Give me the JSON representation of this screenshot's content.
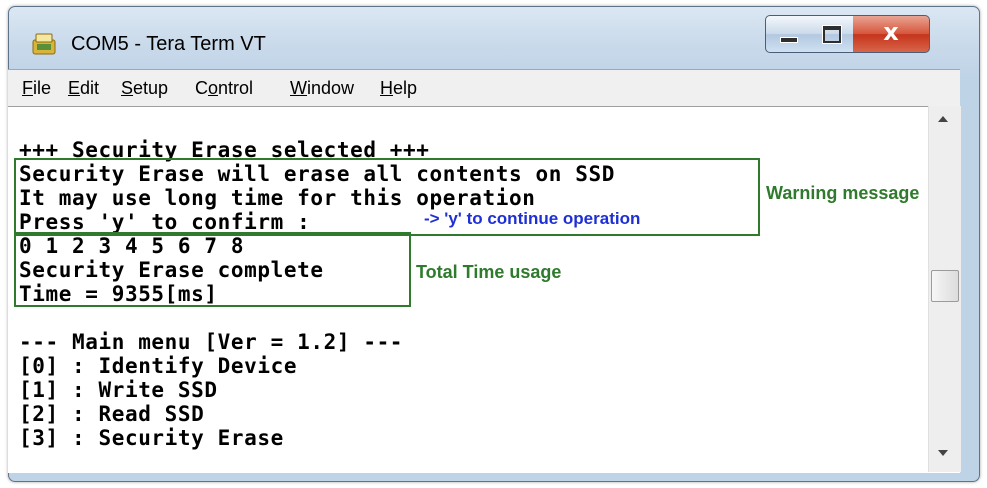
{
  "window": {
    "title": "COM5 - Tera Term VT",
    "controls": {
      "minimize": "minimize",
      "maximize": "maximize",
      "close": "x"
    }
  },
  "menu": [
    {
      "label": "File",
      "mnemonic": "F",
      "rest": "ile"
    },
    {
      "label": "Edit",
      "mnemonic": "E",
      "rest": "dit"
    },
    {
      "label": "Setup",
      "mnemonic": "S",
      "rest": "etup"
    },
    {
      "label": "Control",
      "pre": "C",
      "mnemonic": "o",
      "rest": "ntrol"
    },
    {
      "label": "Window",
      "mnemonic": "W",
      "rest": "indow"
    },
    {
      "label": "Help",
      "mnemonic": "H",
      "rest": "elp"
    }
  ],
  "terminal": {
    "lines": [
      "+++ Security Erase selected +++",
      "Security Erase will erase all contents on SSD",
      "It may use long time for this operation",
      "Press 'y' to confirm :",
      "0 1 2 3 4 5 6 7 8",
      "Security Erase complete",
      "Time = 9355[ms]",
      "",
      "--- Main menu [Ver = 1.2] ---",
      "[0] : Identify Device",
      "[1] : Write SSD",
      "[2] : Read SSD",
      "[3] : Security Erase"
    ]
  },
  "annotations": {
    "warning": "Warning message",
    "continue": "-> 'y' to continue operation",
    "total_time": "Total Time usage",
    "colors": {
      "green": "#2f7a2c",
      "blue": "#1f2fd6",
      "box": "#2f7a2c"
    }
  },
  "scrollbar": {
    "up_icon": "arrow-up-icon",
    "down_icon": "arrow-down-icon"
  }
}
